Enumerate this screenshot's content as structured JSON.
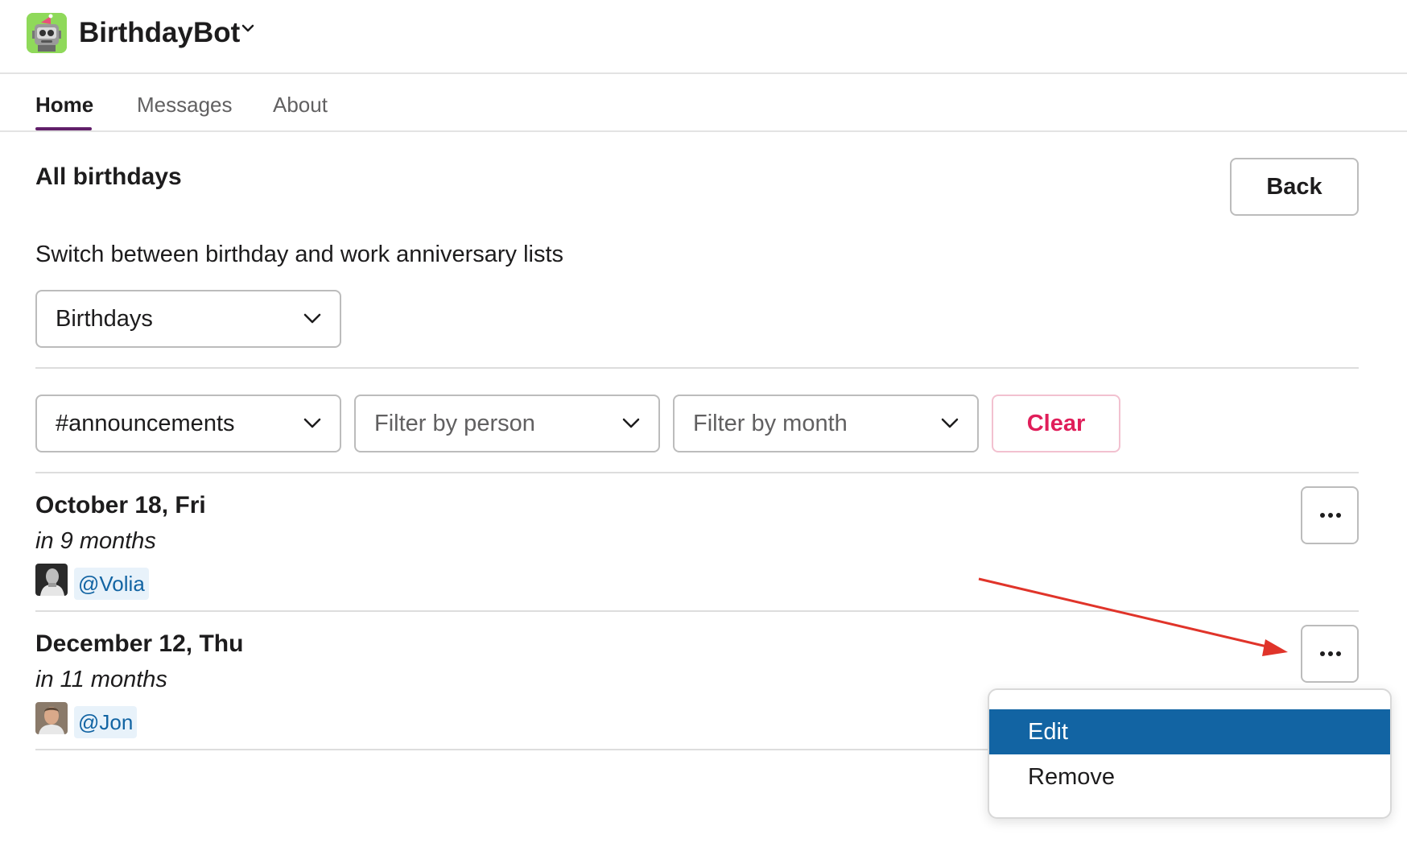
{
  "app": {
    "name": "BirthdayBot"
  },
  "tabs": [
    {
      "label": "Home",
      "active": true
    },
    {
      "label": "Messages",
      "active": false
    },
    {
      "label": "About",
      "active": false
    }
  ],
  "main": {
    "title": "All birthdays",
    "back_label": "Back",
    "switch_text": "Switch between birthday and work anniversary lists",
    "list_select": {
      "value": "Birthdays"
    },
    "filters": {
      "channel": {
        "value": "#announcements"
      },
      "person": {
        "placeholder": "Filter by person"
      },
      "month": {
        "placeholder": "Filter by month"
      },
      "clear_label": "Clear"
    },
    "entries": [
      {
        "date": "October 18, Fri",
        "relative": "in 9 months",
        "mention": "@Volia"
      },
      {
        "date": "December 12, Thu",
        "relative": "in 11 months",
        "mention": "@Jon"
      }
    ],
    "overflow_label": "..."
  },
  "menu": {
    "items": [
      {
        "label": "Edit",
        "highlighted": true
      },
      {
        "label": "Remove",
        "highlighted": false
      }
    ]
  },
  "colors": {
    "accent": "#611f69",
    "clear": "#e01e5a",
    "mention_text": "#1264a3",
    "mention_bg": "#e8f2fa",
    "menu_highlight": "#1264a3",
    "annotation": "#e0342a"
  },
  "icons": {
    "logo": "robot-icon",
    "chevron": "chevron-down-icon",
    "overflow": "more-horizontal-icon"
  }
}
